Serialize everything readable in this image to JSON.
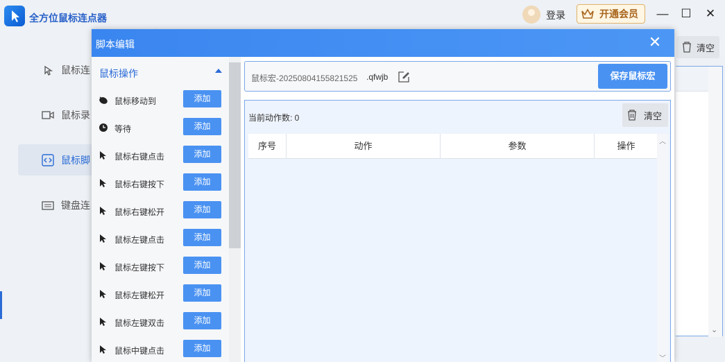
{
  "app": {
    "title": "全方位鼠标连点器",
    "login_label": "登录",
    "vip_label": "开通会员",
    "clear_label": "清空",
    "sidebar": [
      {
        "label": "鼠标连",
        "icon": "mouse-click-icon"
      },
      {
        "label": "鼠标录",
        "icon": "video-record-icon"
      },
      {
        "label": "鼠标脚",
        "icon": "code-script-icon",
        "active": true
      },
      {
        "label": "键盘连",
        "icon": "keyboard-icon"
      }
    ]
  },
  "dialog": {
    "title": "脚本编辑",
    "category": "鼠标操作",
    "add_label": "添加",
    "operations": [
      {
        "label": "鼠标移动到",
        "icon": "mouse-move-icon"
      },
      {
        "label": "等待",
        "icon": "clock-icon"
      },
      {
        "label": "鼠标右键点击",
        "icon": "cursor-icon"
      },
      {
        "label": "鼠标右键按下",
        "icon": "cursor-icon"
      },
      {
        "label": "鼠标右键松开",
        "icon": "cursor-icon"
      },
      {
        "label": "鼠标左键点击",
        "icon": "cursor-icon"
      },
      {
        "label": "鼠标左键按下",
        "icon": "cursor-icon"
      },
      {
        "label": "鼠标左键松开",
        "icon": "cursor-icon"
      },
      {
        "label": "鼠标左键双击",
        "icon": "cursor-icon"
      },
      {
        "label": "鼠标中键点击",
        "icon": "cursor-icon"
      }
    ],
    "macro_name": "鼠标宏-20250804155821525",
    "macro_ext": ".qfwjb",
    "save_label": "保存鼠标宏",
    "action_count": "当前动作数: 0",
    "clear_label": "清空",
    "columns": [
      "序号",
      "动作",
      "参数",
      "操作"
    ]
  }
}
